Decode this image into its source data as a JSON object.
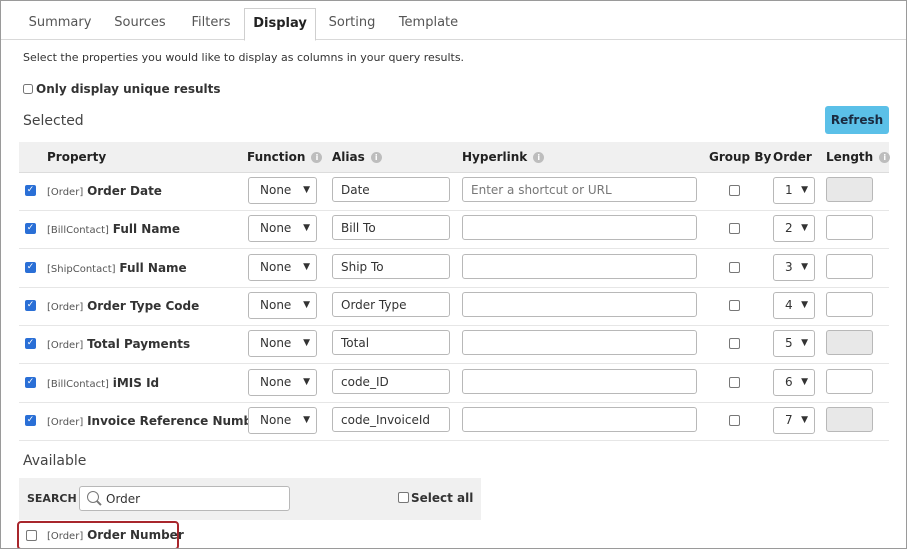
{
  "tabs": [
    "Summary",
    "Sources",
    "Filters",
    "Display",
    "Sorting",
    "Template"
  ],
  "active_tab": "Display",
  "description": "Select the properties you would like to display as columns in your query results.",
  "unique_label": "Only display unique results",
  "selected_title": "Selected",
  "refresh_label": "Refresh",
  "headers": {
    "property": "Property",
    "function": "Function",
    "alias": "Alias",
    "hyperlink": "Hyperlink",
    "group_by": "Group By",
    "order": "Order",
    "length": "Length"
  },
  "info_glyph": "i",
  "check_glyph": "✓",
  "hyperlink_placeholder": "Enter a shortcut or URL",
  "rows": [
    {
      "tag": "[Order]",
      "name": "Order Date",
      "function": "None",
      "alias": "Date",
      "order": "1",
      "length_disabled": true
    },
    {
      "tag": "[BillContact]",
      "name": "Full Name",
      "function": "None",
      "alias": "Bill To",
      "order": "2",
      "length_disabled": false
    },
    {
      "tag": "[ShipContact]",
      "name": "Full Name",
      "function": "None",
      "alias": "Ship To",
      "order": "3",
      "length_disabled": false
    },
    {
      "tag": "[Order]",
      "name": "Order Type Code",
      "function": "None",
      "alias": "Order Type",
      "order": "4",
      "length_disabled": false
    },
    {
      "tag": "[Order]",
      "name": "Total Payments",
      "function": "None",
      "alias": "Total",
      "order": "5",
      "length_disabled": true
    },
    {
      "tag": "[BillContact]",
      "name": "iMIS Id",
      "function": "None",
      "alias": "code_ID",
      "order": "6",
      "length_disabled": false
    },
    {
      "tag": "[Order]",
      "name": "Invoice Reference Number",
      "function": "None",
      "alias": "code_InvoiceId",
      "order": "7",
      "length_disabled": true
    }
  ],
  "available_title": "Available",
  "search": {
    "label": "SEARCH",
    "value": "Order",
    "select_all_label": "Select all"
  },
  "available_items": [
    {
      "tag": "[Order]",
      "name": "Order Number"
    }
  ],
  "colors": {
    "accent": "#5bc0e8",
    "checkbox": "#2a6fd6",
    "highlight_border": "#a8262c"
  }
}
